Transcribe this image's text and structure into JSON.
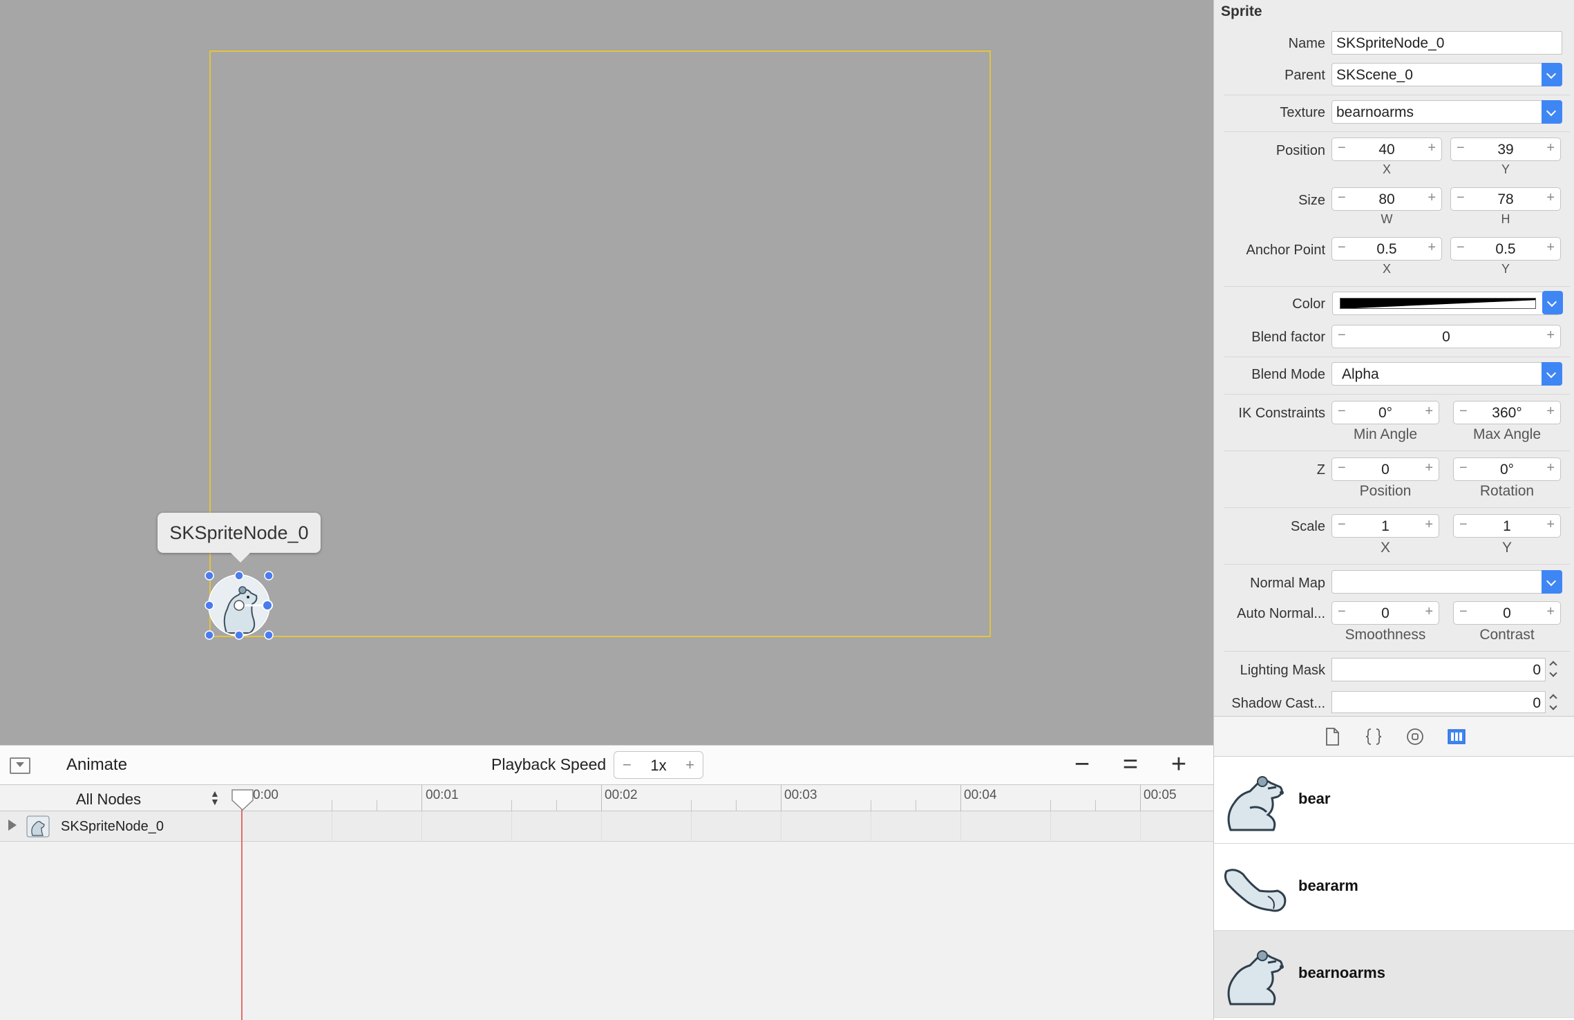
{
  "canvas": {
    "tooltip": "SKSpriteNode_0"
  },
  "animate_bar": {
    "title": "Animate",
    "playback_label": "Playback Speed",
    "speed_minus": "−",
    "speed_value": "1x",
    "speed_plus": "+",
    "zoom_out": "−",
    "zoom_fit": "=",
    "zoom_in": "+"
  },
  "timeline": {
    "filter": "All Nodes",
    "ticks": [
      "0:00",
      "00:01",
      "00:02",
      "00:03",
      "00:04",
      "00:05"
    ],
    "node_name": "SKSpriteNode_0"
  },
  "inspector": {
    "title": "Sprite",
    "name_label": "Name",
    "name_value": "SKSpriteNode_0",
    "parent_label": "Parent",
    "parent_value": "SKScene_0",
    "texture_label": "Texture",
    "texture_value": "bearnoarms",
    "position_label": "Position",
    "position_x": "40",
    "position_y": "39",
    "x_label": "X",
    "y_label": "Y",
    "size_label": "Size",
    "size_w": "80",
    "size_h": "78",
    "w_label": "W",
    "h_label": "H",
    "anchor_label": "Anchor Point",
    "anchor_x": "0.5",
    "anchor_y": "0.5",
    "color_label": "Color",
    "blend_factor_label": "Blend factor",
    "blend_factor_value": "0",
    "blend_mode_label": "Blend Mode",
    "blend_mode_value": "Alpha",
    "ik_label": "IK Constraints",
    "ik_min": "0°",
    "ik_max": "360°",
    "ik_min_label": "Min Angle",
    "ik_max_label": "Max Angle",
    "z_label": "Z",
    "z_position": "0",
    "z_rotation": "0°",
    "z_position_label": "Position",
    "z_rotation_label": "Rotation",
    "scale_label": "Scale",
    "scale_x": "1",
    "scale_y": "1",
    "normal_map_label": "Normal Map",
    "normal_map_value": "",
    "auto_normal_label": "Auto Normal...",
    "smoothness": "0",
    "contrast": "0",
    "smoothness_label": "Smoothness",
    "contrast_label": "Contrast",
    "lighting_mask_label": "Lighting Mask",
    "lighting_mask_value": "0",
    "shadow_cast_label": "Shadow Cast...",
    "shadow_cast_value": "0",
    "minus": "−",
    "plus": "+"
  },
  "library": {
    "tabs": [
      "file-icon",
      "braces-icon",
      "circle-target-icon",
      "media-library-icon"
    ],
    "items": [
      {
        "name": "bear"
      },
      {
        "name": "beararm"
      },
      {
        "name": "bearnoarms"
      }
    ],
    "selected_index": 2
  },
  "colors": {
    "canvas_bg": "#a6a6a6",
    "scene_frame": "#e3c43e",
    "accent": "#3f86f5",
    "playhead": "#e06d6d"
  }
}
